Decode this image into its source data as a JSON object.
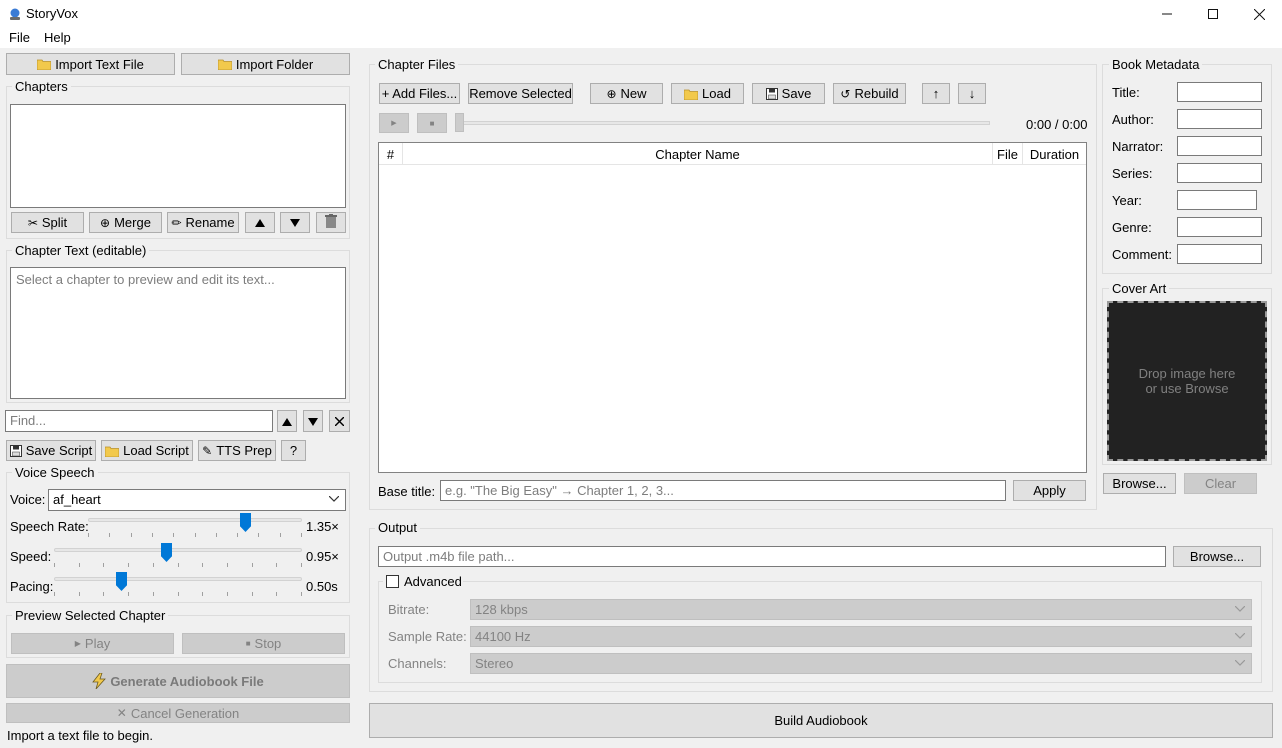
{
  "app": {
    "title": "StoryVox",
    "window_controls": [
      "minimize-icon",
      "maximize-icon",
      "close-icon"
    ]
  },
  "menu": {
    "file": "File",
    "help": "Help"
  },
  "left": {
    "import_text_file": "Import Text File",
    "import_folder": "Import Folder",
    "chapters_title": "Chapters",
    "split": "Split",
    "merge": "Merge",
    "rename": "Rename",
    "chapter_text_title": "Chapter Text (editable)",
    "chapter_text_placeholder": "Select a chapter to preview and edit its text...",
    "find_placeholder": "Find...",
    "save_script": "Save Script",
    "load_script": "Load Script",
    "tts_prep": "TTS Prep",
    "help_q": "?",
    "voice_title": "Voice  Speech",
    "voice_label": "Voice:",
    "voice_value": "af_heart",
    "speech_rate_label": "Speech Rate:",
    "speech_rate_value": "1.35×",
    "speech_rate_level": 0.75,
    "speed_label": "Speed:",
    "speed_value": "0.95×",
    "speed_level": 0.45,
    "pacing_label": "Pacing:",
    "pacing_value": "0.50s",
    "pacing_level": 0.26,
    "preview_title": "Preview Selected Chapter",
    "play": "Play",
    "stop": "Stop",
    "generate": "Generate Audiobook File",
    "cancel": "Cancel Generation",
    "status": "Import a text file to begin."
  },
  "center": {
    "chapter_files_title": "Chapter Files",
    "add_files": "+ Add Files...",
    "remove_selected": "Remove Selected",
    "new": "New",
    "load": "Load",
    "save": "Save",
    "rebuild": "Rebuild",
    "up_arrow": "↑",
    "down_arrow": "↓",
    "time": "0:00 / 0:00",
    "columns": [
      "#",
      "Chapter Name",
      "File",
      "Duration"
    ],
    "base_title_label": "Base title:",
    "base_title_placeholder": "e.g. \"The Big Easy\" → Chapter 1, 2, 3...",
    "apply": "Apply",
    "output_title": "Output",
    "output_placeholder": "Output .m4b file path...",
    "browse": "Browse...",
    "advanced": "Advanced",
    "bitrate_label": "Bitrate:",
    "bitrate_value": "128 kbps",
    "sample_rate_label": "Sample Rate:",
    "sample_rate_value": "44100 Hz",
    "channels_label": "Channels:",
    "channels_value": "Stereo",
    "build": "Build Audiobook"
  },
  "right": {
    "metadata_title": "Book Metadata",
    "fields": [
      "Title:",
      "Author:",
      "Narrator:",
      "Series:",
      "Year:",
      "Genre:",
      "Comment:"
    ],
    "cover_title": "Cover Art",
    "cover_line1": "Drop image here",
    "cover_line2": "or use Browse",
    "browse": "Browse...",
    "clear": "Clear"
  }
}
